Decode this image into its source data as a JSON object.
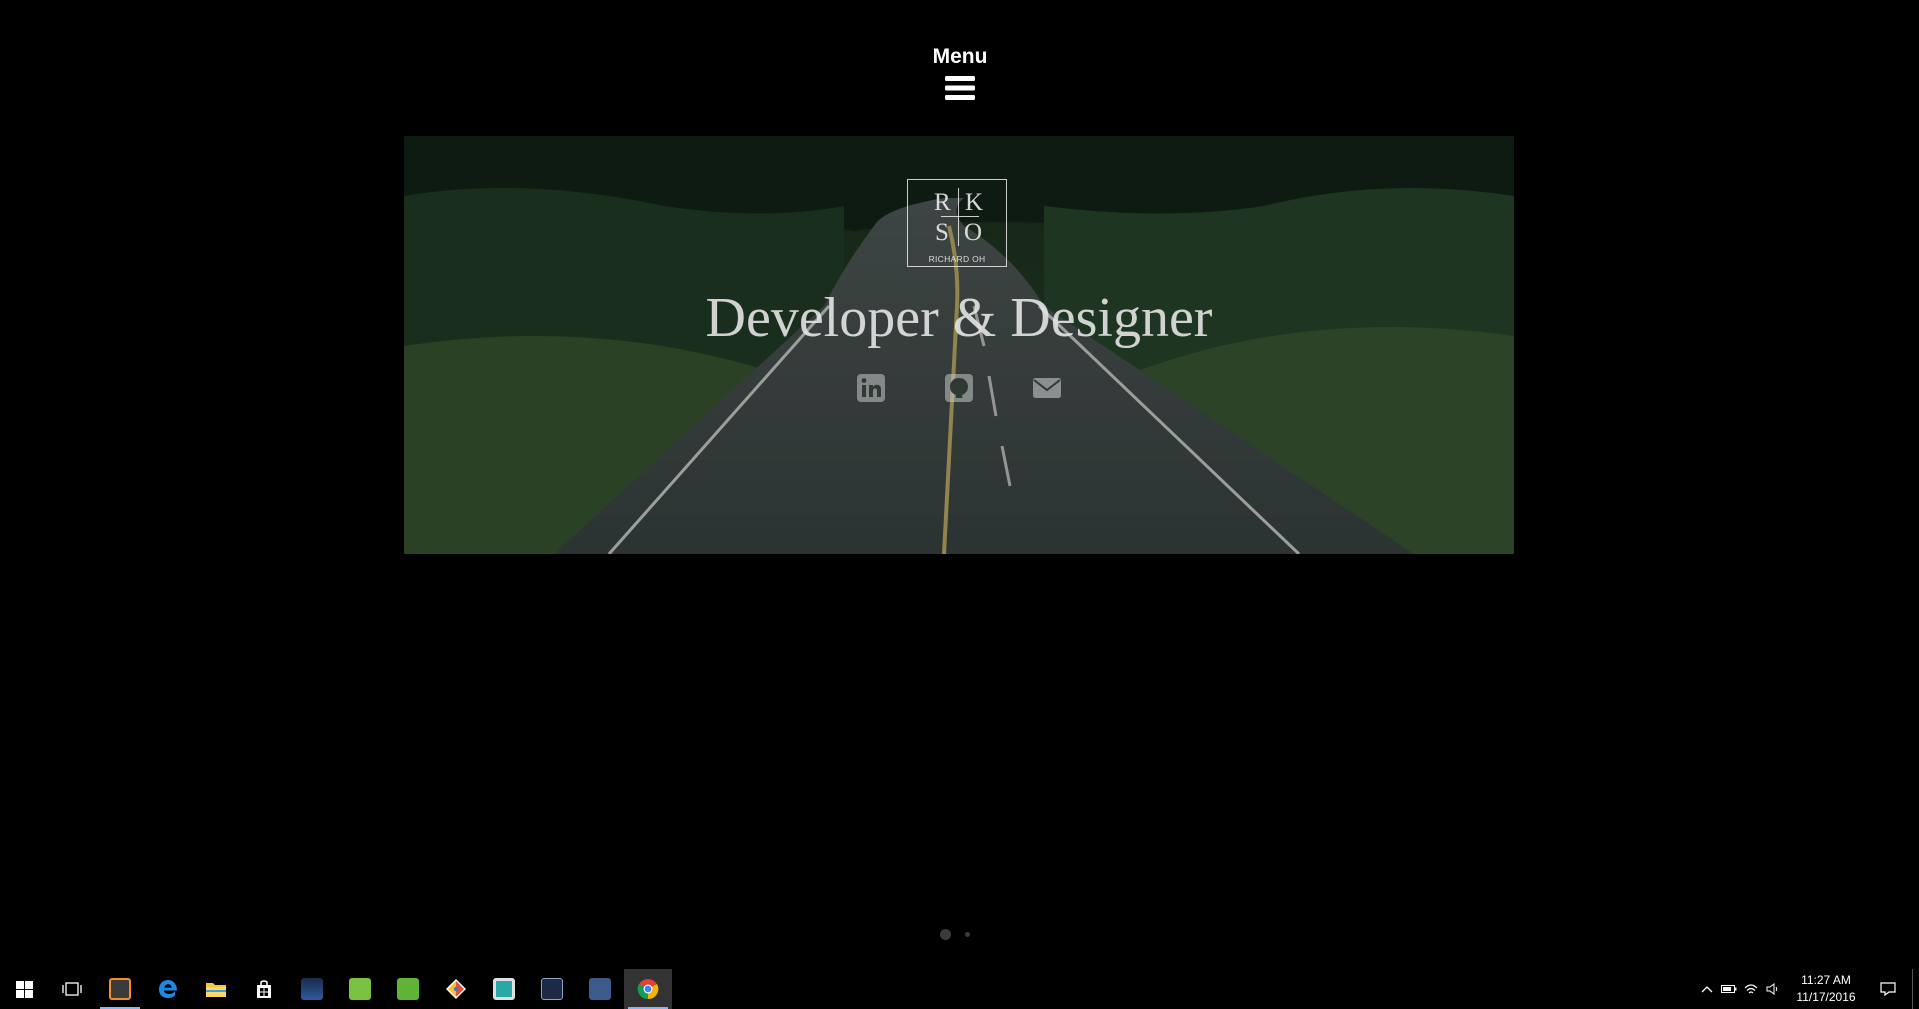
{
  "menu": {
    "label": "Menu",
    "icon": "hamburger-icon"
  },
  "hero": {
    "logo": {
      "letters": [
        "R",
        "K",
        "S",
        "O"
      ],
      "subtitle": "RICHARD OH"
    },
    "headline": "Developer & Designer",
    "socials": [
      {
        "name": "linkedin",
        "icon": "linkedin-icon"
      },
      {
        "name": "github",
        "icon": "github-icon"
      },
      {
        "name": "email",
        "icon": "envelope-icon"
      }
    ]
  },
  "pager": {
    "total": 2,
    "active": 1
  },
  "taskbar": {
    "apps": [
      "start",
      "task-view",
      "sublime-text",
      "edge",
      "file-explorer",
      "store",
      "kindle",
      "wechat",
      "evernote",
      "git",
      "sublime-merge",
      "mysql-workbench",
      "visual-studio",
      "chrome"
    ],
    "active_app": "chrome",
    "clock": {
      "time": "11:27 AM",
      "date": "11/17/2016"
    }
  },
  "colors": {
    "background": "#000000",
    "text": "#ffffff",
    "taskbar_accent": "#8ab4f8"
  }
}
